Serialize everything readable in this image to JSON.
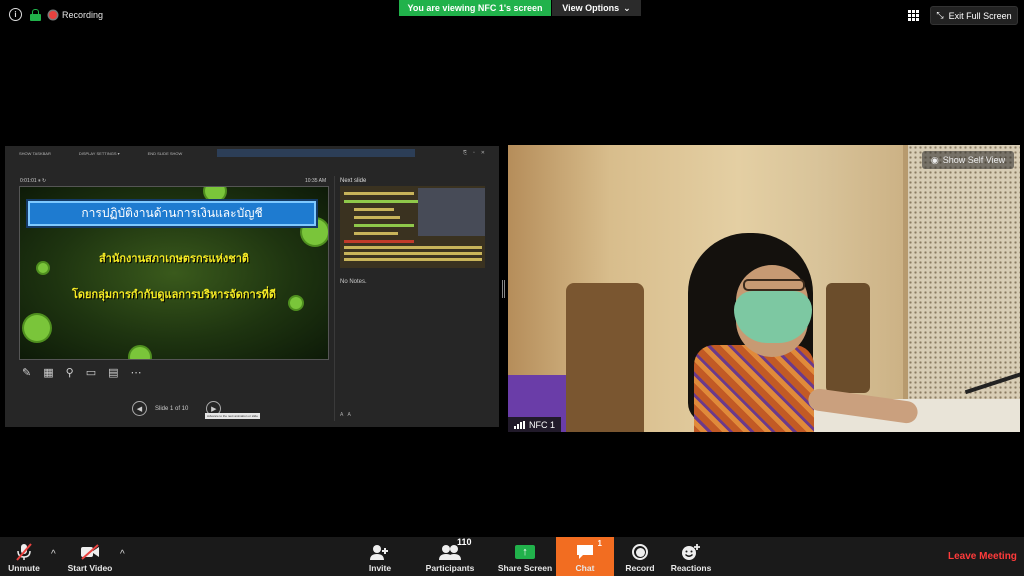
{
  "top_bar": {
    "recording_label": "Recording",
    "viewing_banner": "You are viewing NFC 1's screen",
    "view_options_label": "View Options",
    "exit_fullscreen_label": "Exit Full Screen",
    "colors": {
      "banner_green": "#21b24b",
      "recording_red": "#e8423f",
      "lock_green": "#21b24b"
    }
  },
  "shared_screen": {
    "presenter_toolbar": [
      "SHOW TASKBAR",
      "DISPLAY SETTINGS ▾",
      "END SLIDE SHOW"
    ],
    "timer": "0:01:01",
    "clock": "10:35 AM",
    "slide": {
      "title": "การปฏิบัติงานด้านการเงินและบัญชี",
      "line1": "สำนักงานสภาเกษตรกรแห่งชาติ",
      "line2": "โดยกลุ่มการกำกับดูแลการบริหารจัดการที่ดี"
    },
    "next_slide_label": "Next slide",
    "notes": "No Notes.",
    "slide_counter": "Slide 1 of 10",
    "tooltip": "Advance to the next animation or slide",
    "tool_icons": [
      "pen-icon",
      "slides-icon",
      "zoom-icon",
      "screen-icon",
      "subtitles-icon",
      "more-icon"
    ]
  },
  "video": {
    "participant_name": "NFC 1",
    "self_view_label": "Show Self View"
  },
  "toolbar": {
    "unmute": "Unmute",
    "start_video": "Start Video",
    "invite": "Invite",
    "participants": "Participants",
    "participants_count": "110",
    "share_screen": "Share Screen",
    "chat": "Chat",
    "chat_badge": "1",
    "record": "Record",
    "reactions": "Reactions",
    "leave": "Leave Meeting",
    "colors": {
      "chat_bg": "#f26d21",
      "leave_red": "#ff3b3b",
      "share_green": "#21b24b"
    }
  }
}
